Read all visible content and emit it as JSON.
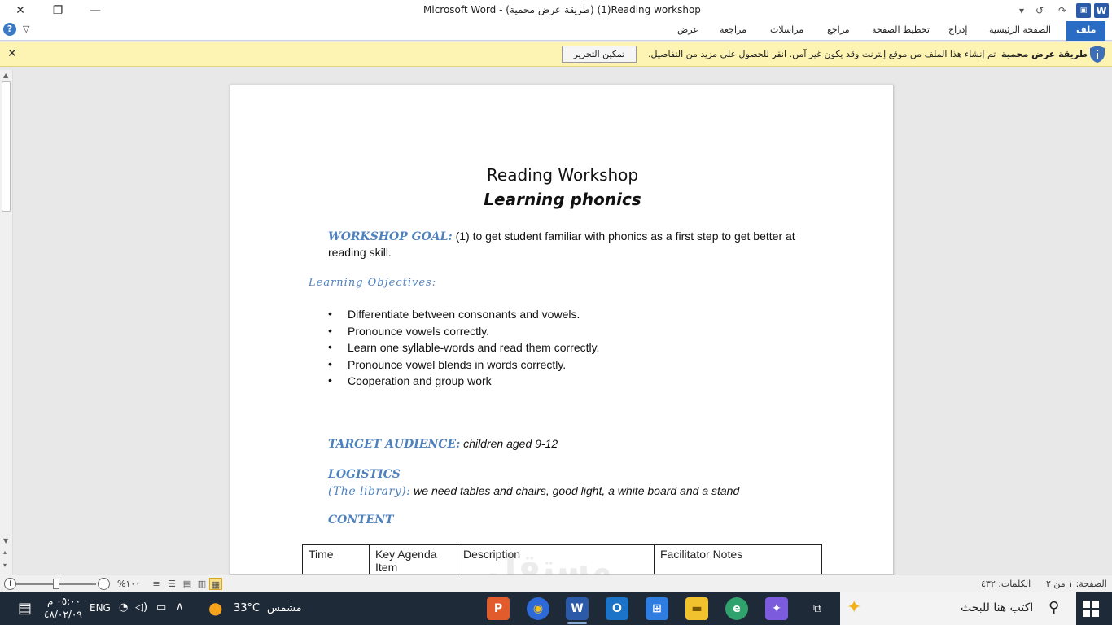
{
  "window": {
    "title": "Microsoft Word  -  (طريقة عرض محمية) (1)Reading workshop",
    "close_glyph": "✕",
    "restore_glyph": "❐",
    "minimize_glyph": "—",
    "qat": {
      "customize": "▾",
      "undo_repeat": "↺",
      "redo": "↷",
      "undo": "↶",
      "save": "💾",
      "word_logo": "W"
    }
  },
  "ribbon": {
    "tabs": [
      {
        "label": "ملف",
        "active": true
      },
      {
        "label": "الصفحة الرئيسية"
      },
      {
        "label": "إدراج"
      },
      {
        "label": "تخطيط الصفحة"
      },
      {
        "label": "مراجع"
      },
      {
        "label": "مراسلات"
      },
      {
        "label": "مراجعة"
      },
      {
        "label": "عرض"
      }
    ],
    "help_glyph": "?",
    "minimize_glyph": "♡"
  },
  "protected_view": {
    "label": "طريقة عرض محمية",
    "message": "تم إنشاء هذا الملف من موقع إنترنت وقد يكون غير آمن. انقر للحصول على مزيد من التفاصيل.",
    "enable_button": "تمكين التحرير",
    "close_glyph": "✕"
  },
  "document": {
    "title": "Reading Workshop",
    "subtitle": "Learning phonics",
    "goal_label": "WORKSHOP GOAL:",
    "goal_text": " (1) to get student  familiar with phonics as a first step  to get better at reading skill.",
    "objectives_label": "Learning Objectives:",
    "objectives": [
      "Differentiate between consonants  and vowels.",
      "Pronounce vowels correctly.",
      "Learn one syllable-words and read them correctly.",
      "Pronounce vowel blends in words correctly.",
      "Cooperation and group work"
    ],
    "audience_label": "TARGET AUDIENCE:",
    "audience_text": " children aged 9-12",
    "logistics_label": "LOGISTICS",
    "library_label": "(The library):",
    "library_text": " we need tables and chairs, good light, a white board and a stand",
    "content_label": "CONTENT",
    "table_headers": [
      "Time",
      "Key Agenda Item",
      "Description",
      "Facilitator Notes"
    ]
  },
  "statusbar": {
    "page": "الصفحة: ١ من ٢",
    "words": "الكلمات: ٤٣٢",
    "zoom": "%١٠٠",
    "zoom_level_percent": 100
  },
  "taskbar": {
    "search_placeholder": "اكتب هنا للبحث",
    "weather_temp": "33°C",
    "weather_desc": "مشمس",
    "language": "ENG",
    "time": "٠٥:٠٠ م",
    "date": "٤٨/٠٢/٠٩",
    "watermark": "مستقل"
  }
}
